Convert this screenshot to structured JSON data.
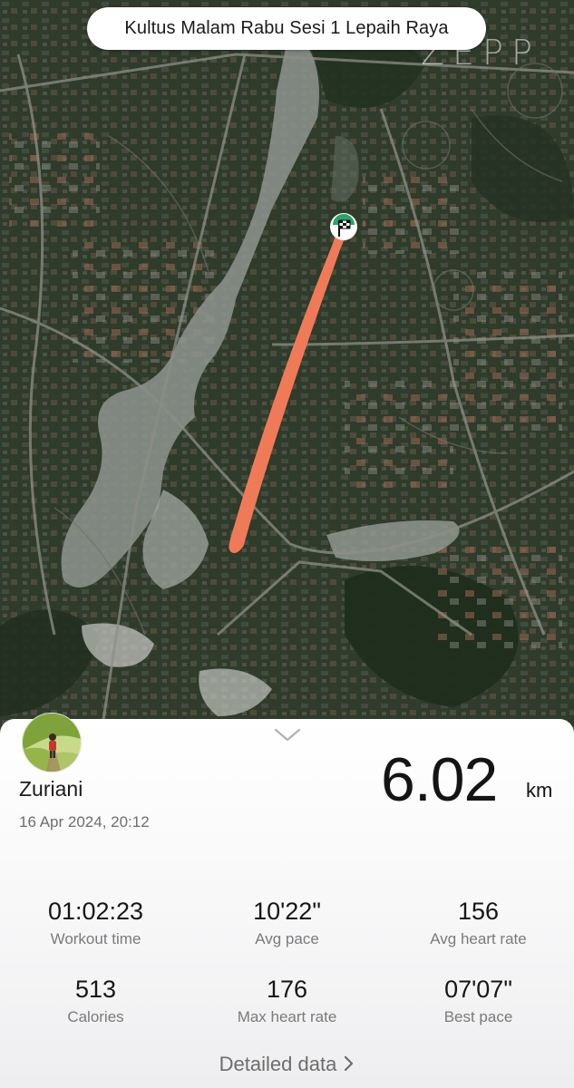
{
  "map": {
    "title": "Kultus Malam Rabu Sesi 1 Lepaih Raya",
    "watermark": "ZEPP"
  },
  "icons": {
    "finish_flag": "checkered-flag-icon",
    "collapse": "chevron-down-icon",
    "detail_arrow": "chevron-right-icon"
  },
  "colors": {
    "route": "#f07a57",
    "flag_marker": "#2aa36b"
  },
  "summary": {
    "user_name": "Zuriani",
    "date": "16 Apr 2024, 20:12",
    "distance_value": "6.02",
    "distance_unit": "km"
  },
  "stats": [
    {
      "value": "01:02:23",
      "label": "Workout time"
    },
    {
      "value": "10'22\"",
      "label": "Avg pace"
    },
    {
      "value": "156",
      "label": "Avg heart rate"
    },
    {
      "value": "513",
      "label": "Calories"
    },
    {
      "value": "176",
      "label": "Max heart rate"
    },
    {
      "value": "07'07\"",
      "label": "Best pace"
    }
  ],
  "footer": {
    "detail_label": "Detailed data"
  }
}
